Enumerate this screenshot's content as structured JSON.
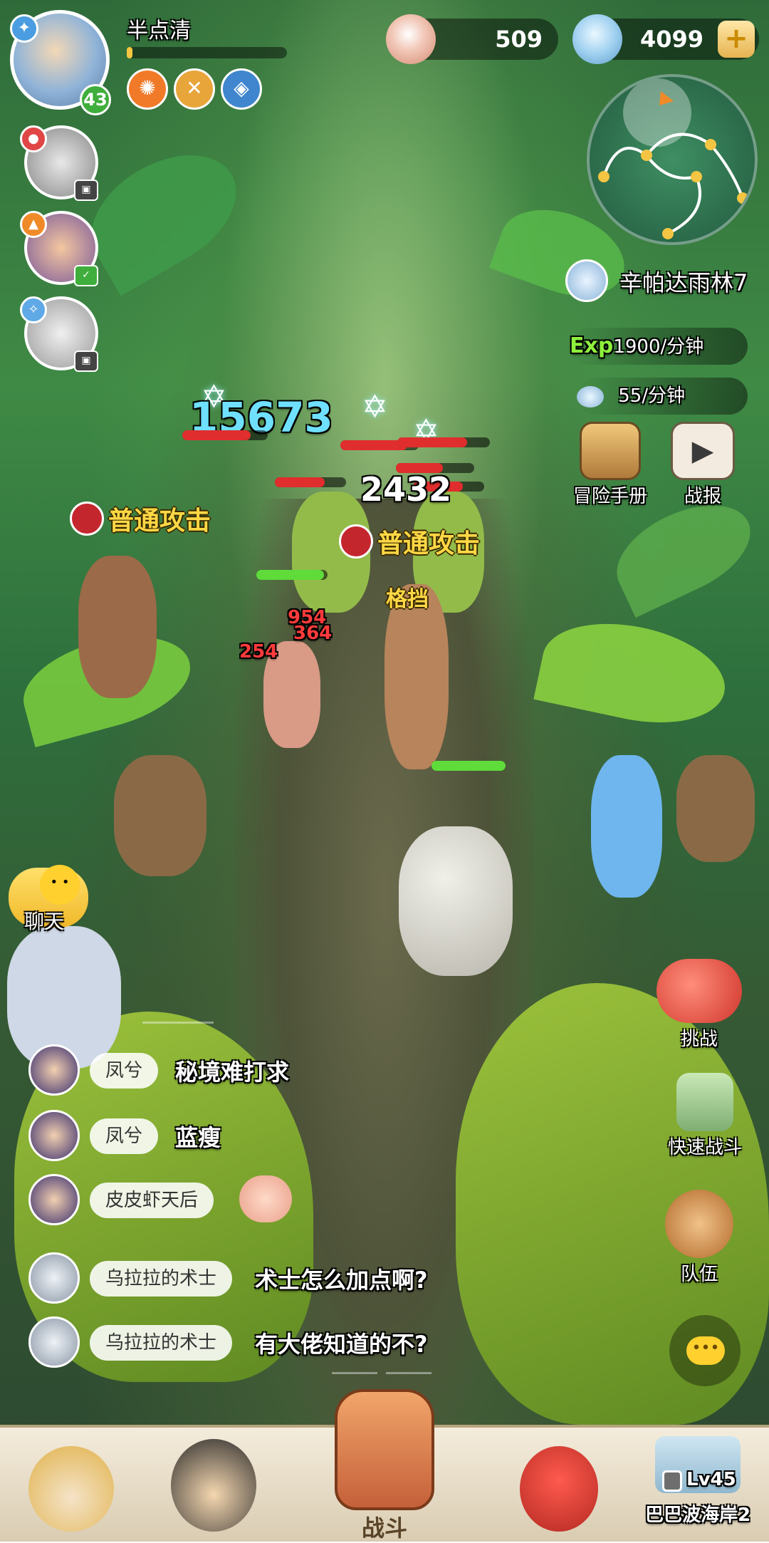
{
  "player": {
    "name": "半点清",
    "level": "43"
  },
  "currency": {
    "pearls": "509",
    "gems": "4099",
    "add_label": "+"
  },
  "map": {
    "location": "辛帕达雨林7",
    "exp_label": "Exp",
    "exp_rate": "1900/分钟",
    "gem_rate": "55/分钟"
  },
  "side_buttons": {
    "handbook": "冒险手册",
    "battle_report": "战报",
    "challenge": "挑战",
    "quick_battle": "快速战斗",
    "team": "队伍"
  },
  "combat": {
    "big_damage": "15673",
    "damage_2": "2432",
    "red_1": "954",
    "red_2": "364",
    "red_3": "254",
    "attack_1": "普通攻击",
    "attack_2": "普通攻击",
    "block": "格挡"
  },
  "chat": {
    "button_label": "聊天",
    "messages": [
      {
        "name": "凤兮",
        "text": "秘境难打求"
      },
      {
        "name": "凤兮",
        "text": "蓝瘦"
      },
      {
        "name": "皮皮虾天后",
        "text": ""
      },
      {
        "name": "乌拉拉的术士",
        "text": "术士怎么加点啊?"
      },
      {
        "name": "乌拉拉的术士",
        "text": "有大佬知道的不?"
      }
    ]
  },
  "bottom_nav": {
    "battle_label": "战斗",
    "locked_level": "Lv45",
    "locked_name": "巴巴波海岸2"
  },
  "colors": {
    "accent_gold": "#ffd845",
    "damage_cyan": "#6fe0ff",
    "damage_red": "#ff3b3b",
    "exp_green": "#8ef03c"
  }
}
